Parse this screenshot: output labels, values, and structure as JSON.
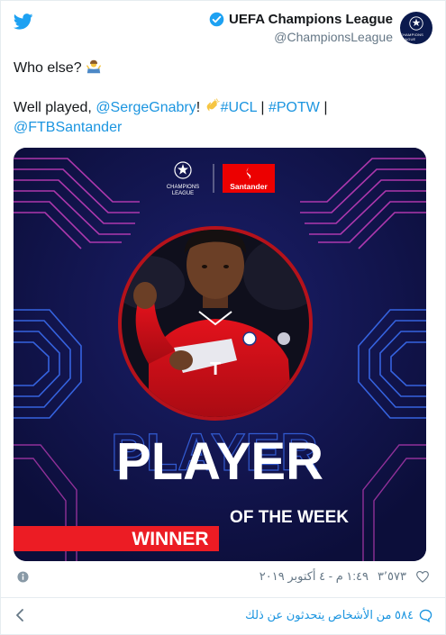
{
  "tweet": {
    "author_name": "UEFA Champions League",
    "author_handle": "@ChampionsLeague",
    "avatar_text": "CHAMPIONS LEAGUE",
    "line1": "Who else?",
    "line2_plain": "Well played,",
    "mention_gnabry": "@SergeGnabry",
    "exclamation": "!",
    "hashtag_ucl": "#UCL",
    "separator1": " | ",
    "hashtag_potw": "#POTW",
    "separator2": " |",
    "mention_santander": "@FTBSantander"
  },
  "media": {
    "ucl_logo_text_1": "CHAMPIONS",
    "ucl_logo_text_2": "LEAGUE",
    "sponsor": "Santander",
    "headline": "PLAYER",
    "subheadline": "OF THE WEEK",
    "badge": "WINNER",
    "shirt_brand": "T"
  },
  "meta": {
    "timestamp": "١:٤٩ م - ٤ أكتوبر ٢٠١٩",
    "likes": "٣٬٥٧٣"
  },
  "footer": {
    "people_talking": "٥٨٤ من الأشخاص يتحدثون عن ذلك"
  },
  "colors": {
    "link": "#1b95e0",
    "verified": "#1da1f2",
    "media_bg": "#0f1240",
    "neon": "#c93fbf",
    "santander_red": "#ec0000"
  }
}
